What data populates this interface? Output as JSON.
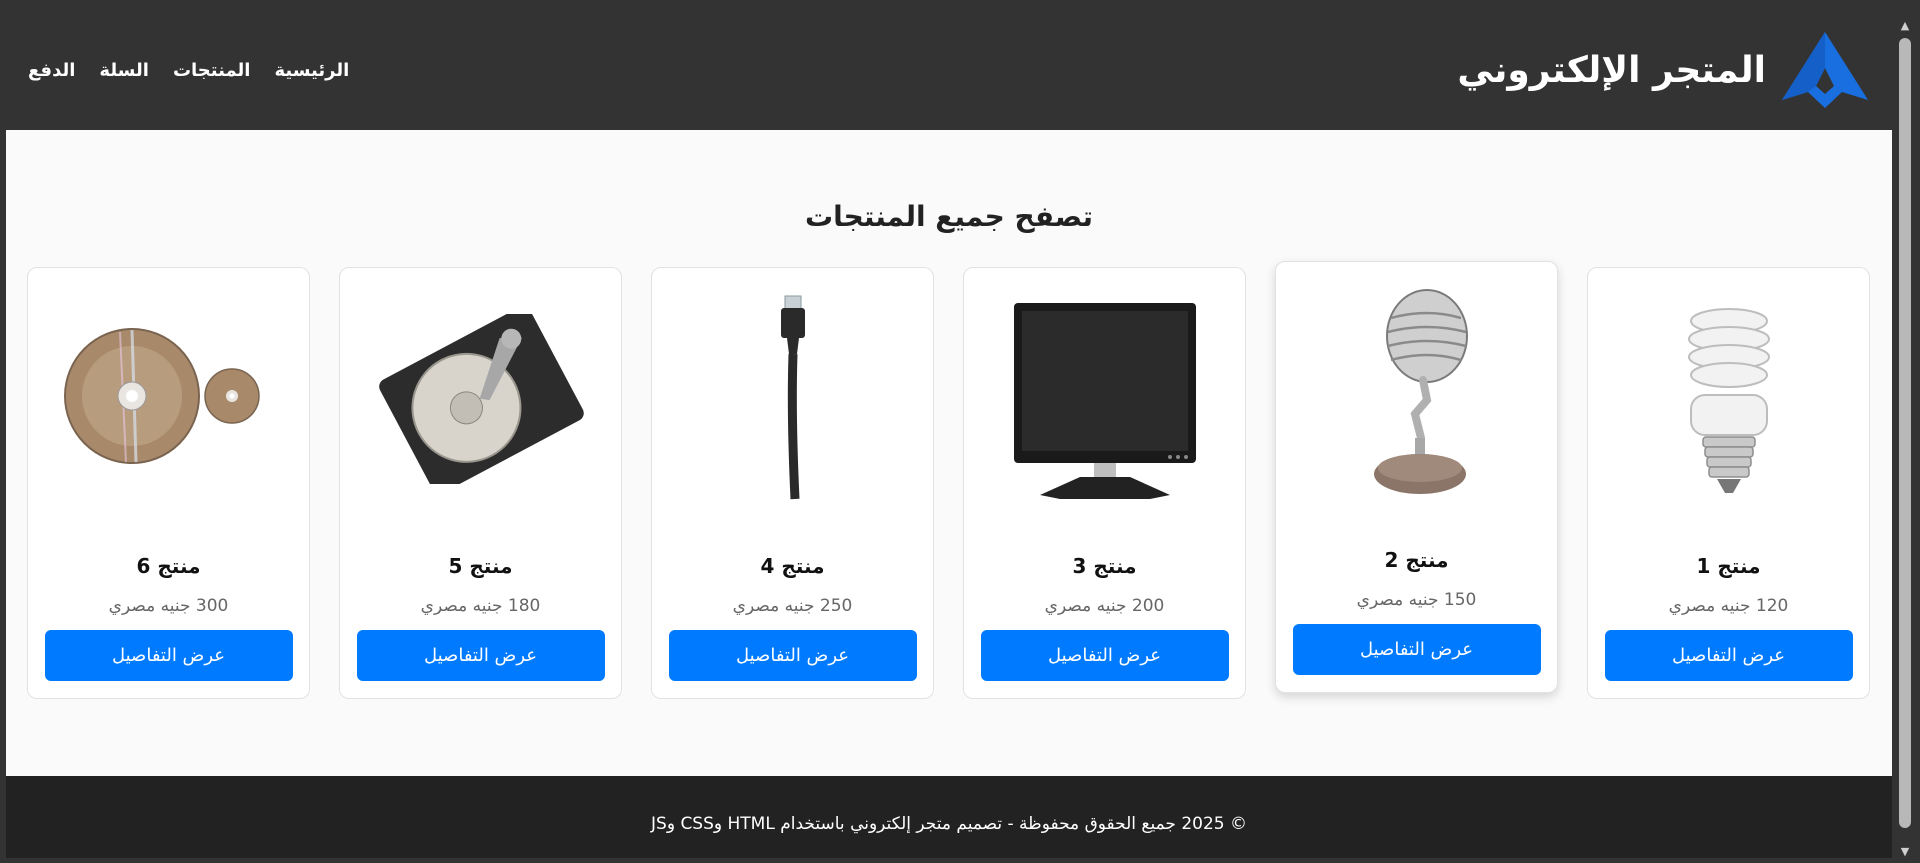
{
  "header": {
    "brand_title": "المتجر الإلكتروني",
    "nav": [
      "الرئيسية",
      "المنتجات",
      "السلة",
      "الدفع"
    ]
  },
  "main": {
    "section_title": "تصفح جميع المنتجات",
    "products": [
      {
        "name": "منتج 1",
        "price": "120 جنيه مصري",
        "button": "عرض التفاصيل",
        "image": "light-bulb"
      },
      {
        "name": "منتج 2",
        "price": "150 جنيه مصري",
        "button": "عرض التفاصيل",
        "image": "microphone"
      },
      {
        "name": "منتج 3",
        "price": "200 جنيه مصري",
        "button": "عرض التفاصيل",
        "image": "monitor"
      },
      {
        "name": "منتج 4",
        "price": "250 جنيه مصري",
        "button": "عرض التفاصيل",
        "image": "network-cable"
      },
      {
        "name": "منتج 5",
        "price": "180 جنيه مصري",
        "button": "عرض التفاصيل",
        "image": "hard-drive"
      },
      {
        "name": "منتج 6",
        "price": "300 جنيه مصري",
        "button": "عرض التفاصيل",
        "image": "discs"
      }
    ]
  },
  "footer": {
    "text": "© 2025 جميع الحقوق محفوظة - تصميم متجر إلكتروني باستخدام HTML وCSS وJS"
  },
  "colors": {
    "header_bg": "#333333",
    "footer_bg": "#222222",
    "accent": "#007bff",
    "logo": "#1a6fe0"
  }
}
